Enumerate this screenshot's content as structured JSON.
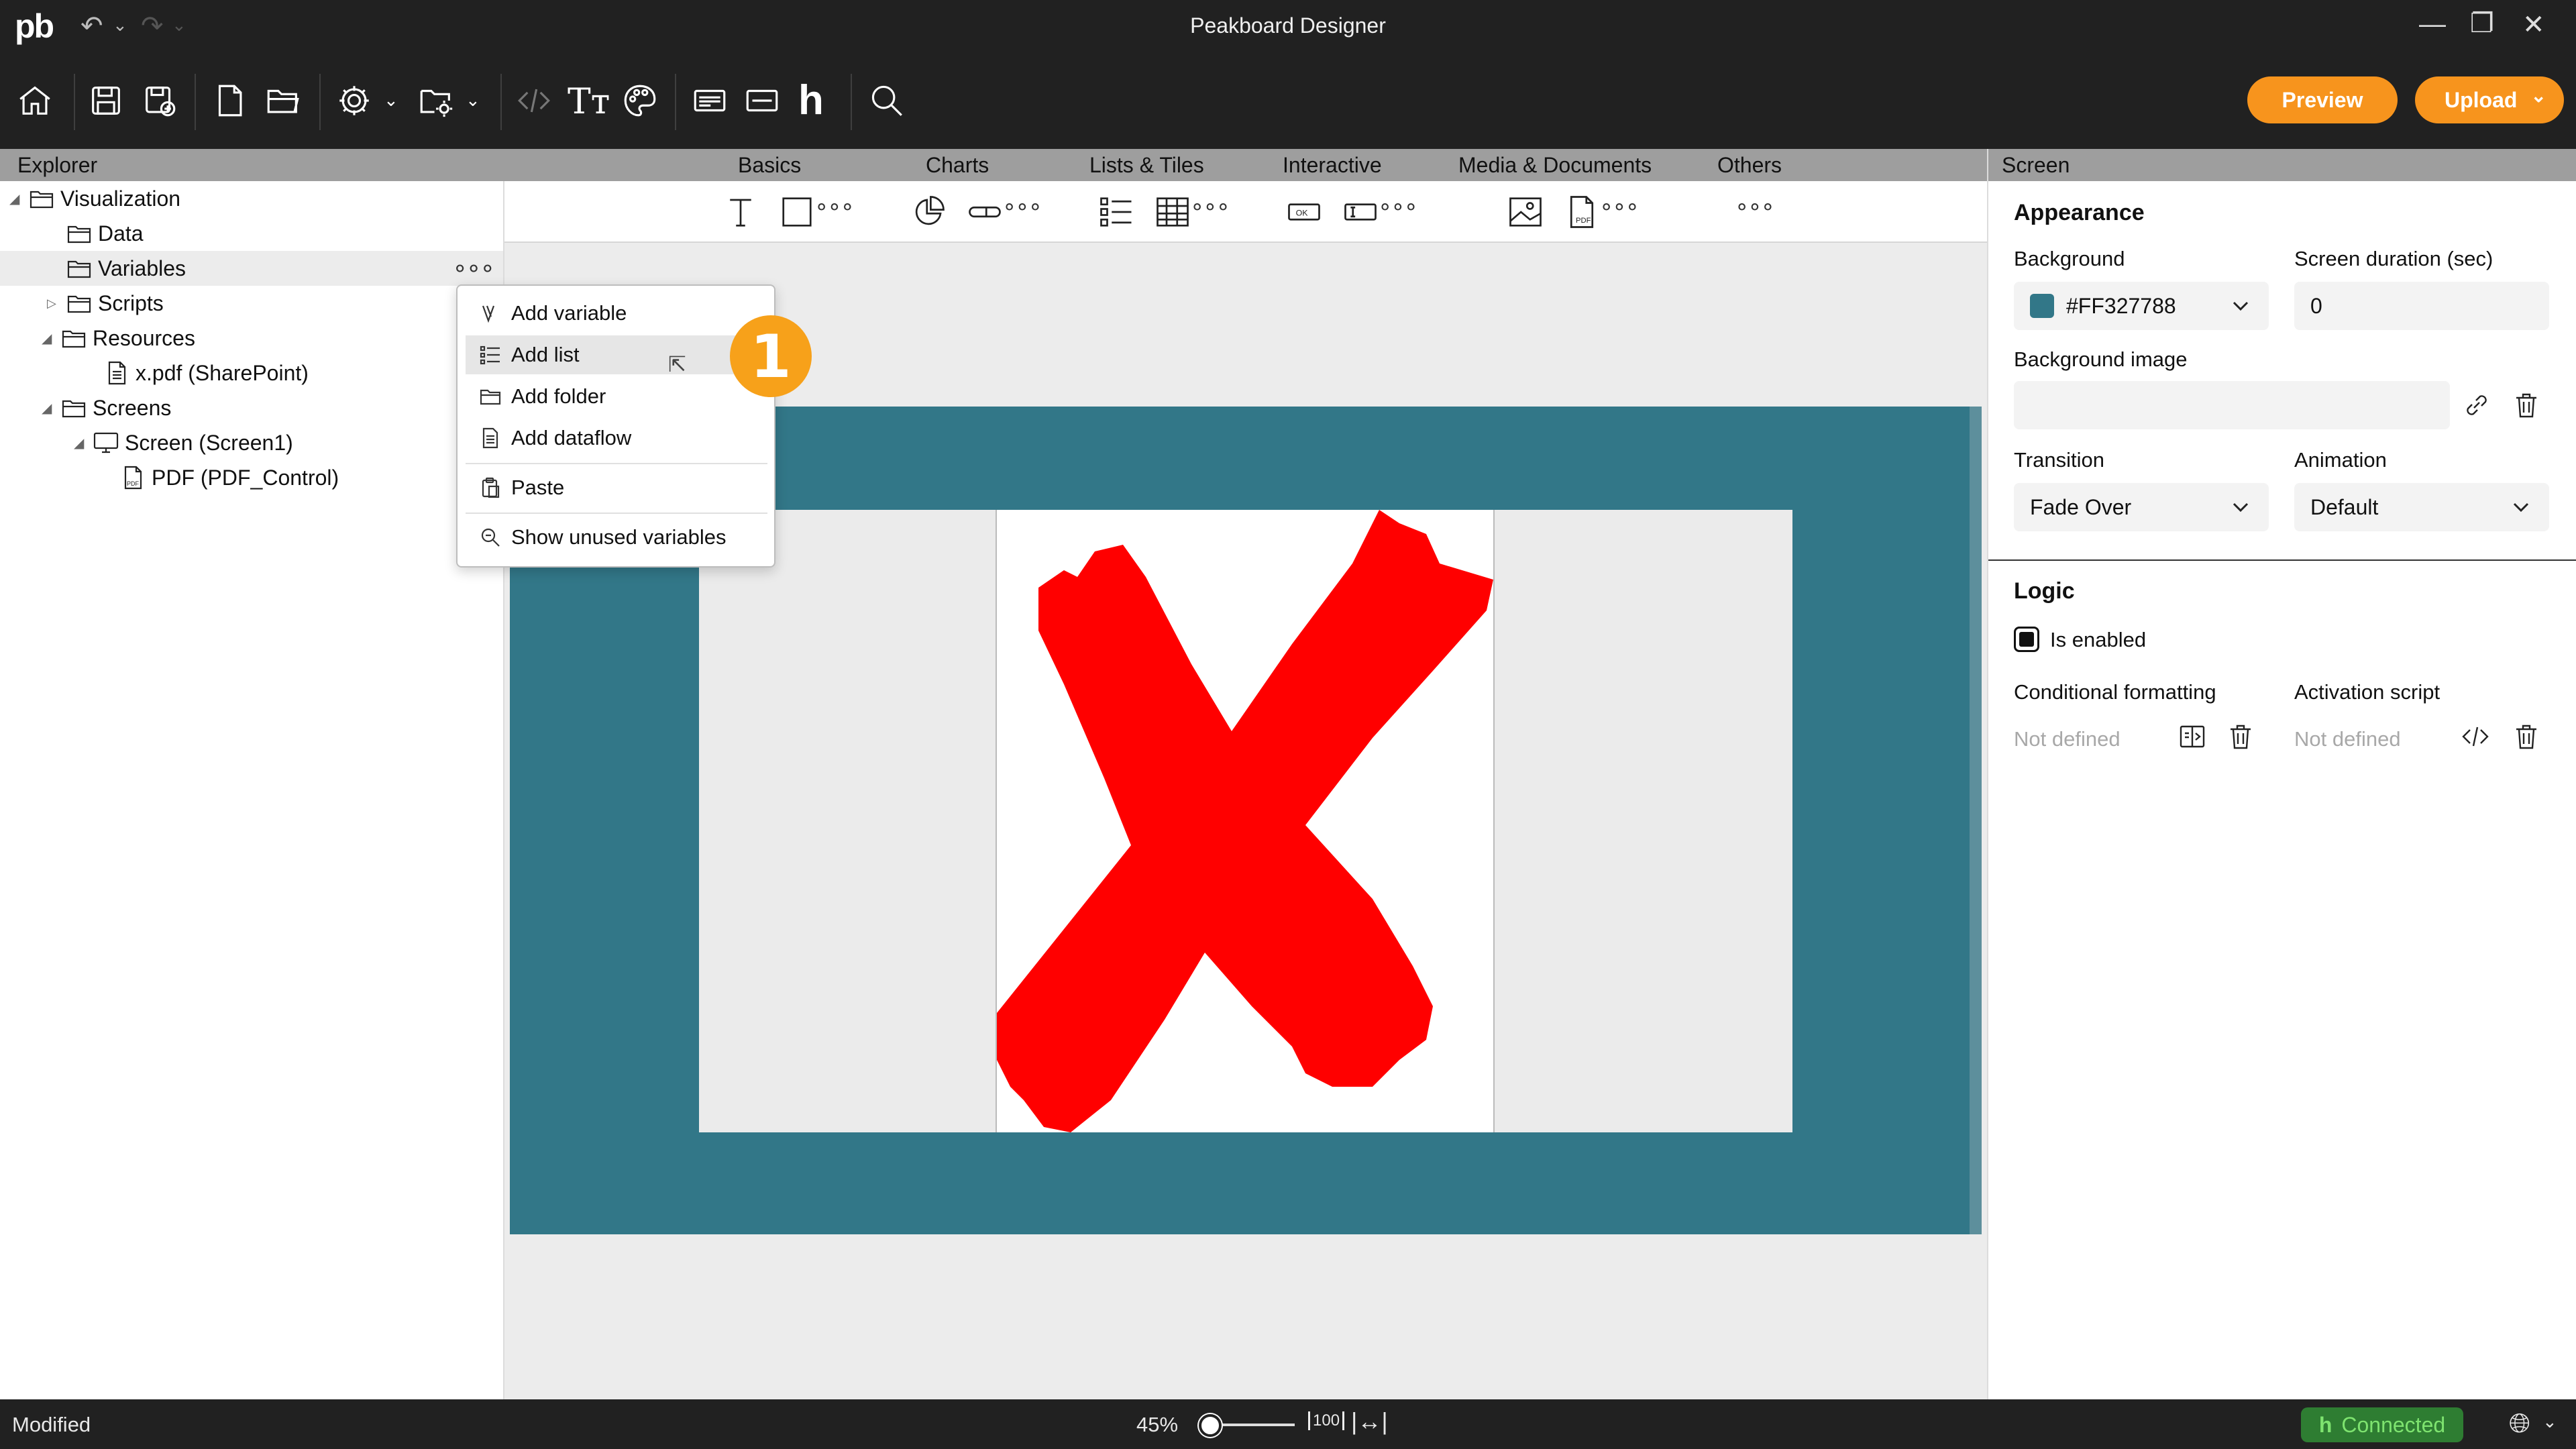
{
  "window": {
    "title": "Peakboard Designer",
    "logo_text": "pb"
  },
  "toolbar": {
    "preview_label": "Preview",
    "upload_label": "Upload",
    "text_tool": "Tт"
  },
  "explorer": {
    "header": "Explorer",
    "items": [
      {
        "label": "Visualization"
      },
      {
        "label": "Data"
      },
      {
        "label": "Variables"
      },
      {
        "label": "Scripts"
      },
      {
        "label": "Resources"
      },
      {
        "label": "x.pdf (SharePoint)"
      },
      {
        "label": "Screens"
      },
      {
        "label": "Screen (Screen1)"
      },
      {
        "label": "PDF  (PDF_Control)"
      }
    ]
  },
  "context_menu": {
    "items": [
      {
        "label": "Add variable",
        "icon": "variable-icon"
      },
      {
        "label": "Add list",
        "icon": "list-icon"
      },
      {
        "label": "Add folder",
        "icon": "folder-icon"
      },
      {
        "label": "Add dataflow",
        "icon": "dataflow-icon"
      },
      {
        "label": "Paste",
        "icon": "paste-icon"
      },
      {
        "label": "Show unused variables",
        "icon": "search-icon"
      }
    ],
    "highlighted": "Add list"
  },
  "step_badge": "1",
  "component_bar": {
    "categories": [
      "Basics",
      "Charts",
      "Lists & Tiles",
      "Interactive",
      "Media & Documents",
      "Others"
    ]
  },
  "canvas": {
    "screen_color": "#327788"
  },
  "properties": {
    "header": "Screen",
    "appearance_heading": "Appearance",
    "background_label": "Background",
    "background_value": "#FF327788",
    "screen_duration_label": "Screen duration (sec)",
    "screen_duration_value": "0",
    "background_image_label": "Background image",
    "background_image_value": "",
    "transition_label": "Transition",
    "transition_value": "Fade Over",
    "animation_label": "Animation",
    "animation_value": "Default",
    "logic_heading": "Logic",
    "is_enabled_label": "Is enabled",
    "is_enabled": true,
    "conditional_formatting_label": "Conditional formatting",
    "conditional_formatting_value": "Not defined",
    "activation_script_label": "Activation script",
    "activation_script_value": "Not defined"
  },
  "status": {
    "left_text": "Modified",
    "zoom": "45%",
    "zoom_fraction": 0.02,
    "fit_100": "100",
    "connection": "Connected"
  },
  "colors": {
    "accent": "#f7941d",
    "titlebar": "#212121",
    "connected_bg": "#2e7d32",
    "x_mark": "#ff0000"
  }
}
